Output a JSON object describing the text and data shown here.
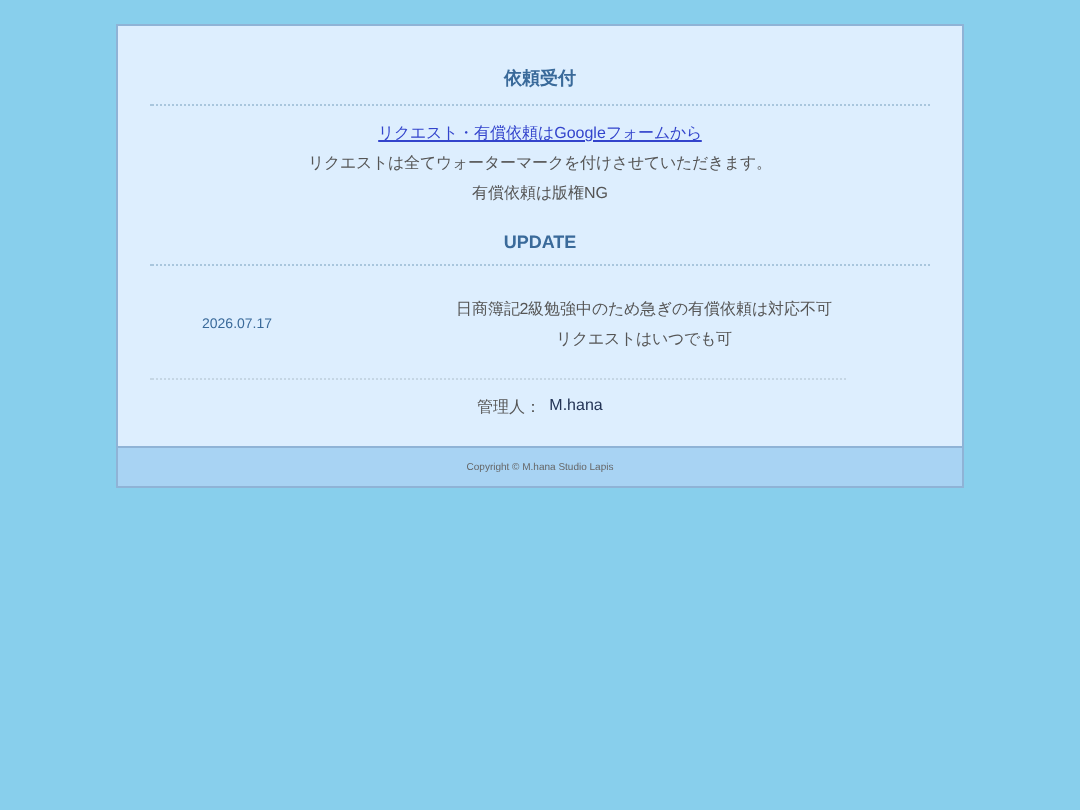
{
  "request_section": {
    "title": "依頼受付",
    "link": "リクエスト・有償依頼はGoogleフォームから",
    "lines": [
      "リクエストは全てウォーターマークを付けさせていただきます。",
      "有償依頼は版権NG"
    ]
  },
  "update_section": {
    "title": "UPDATE",
    "entries": [
      {
        "date": "2026.07.17",
        "lines": [
          "日商簿記2級勉強中のため急ぎの有償依頼は対応不可",
          "リクエストはいつでも可"
        ]
      }
    ]
  },
  "admin": {
    "label": "管理人：",
    "name": "M.hana"
  },
  "footer": {
    "copyright": "Copyright © M.hana Studio Lapis"
  }
}
